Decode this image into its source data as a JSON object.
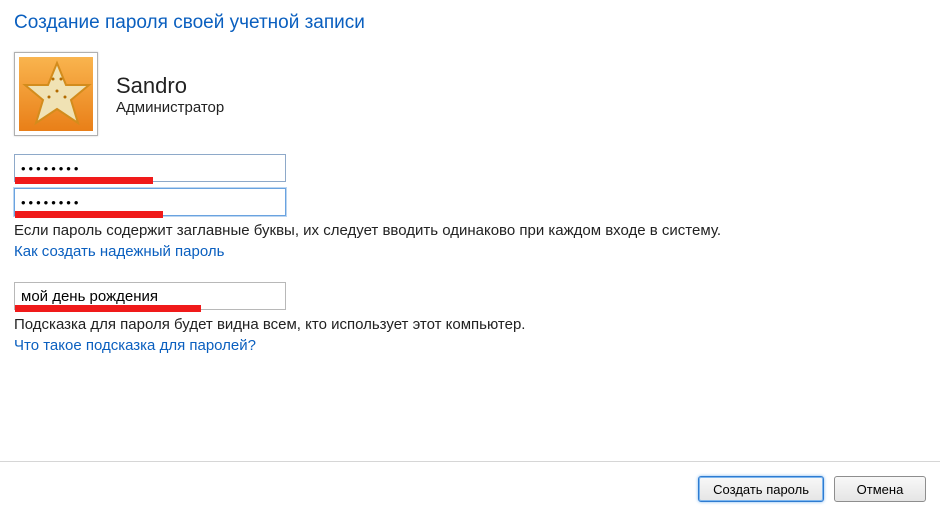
{
  "title": "Создание пароля своей учетной записи",
  "user": {
    "name": "Sandro",
    "role": "Администратор"
  },
  "password_field": {
    "value": "••••••••"
  },
  "confirm_field": {
    "value": "••••••••"
  },
  "caps_note": "Если пароль содержит заглавные буквы, их следует вводить одинаково при каждом входе в систему.",
  "link_strong_pw": "Как создать надежный пароль",
  "hint_field": {
    "value": "мой день рождения"
  },
  "hint_note": "Подсказка для пароля будет видна всем, кто использует этот компьютер.",
  "link_hint_help": "Что такое подсказка для паролей?",
  "buttons": {
    "create": "Создать пароль",
    "cancel": "Отмена"
  },
  "overlay_widths": {
    "pw1": 138,
    "pw2": 148,
    "hint": 186
  }
}
